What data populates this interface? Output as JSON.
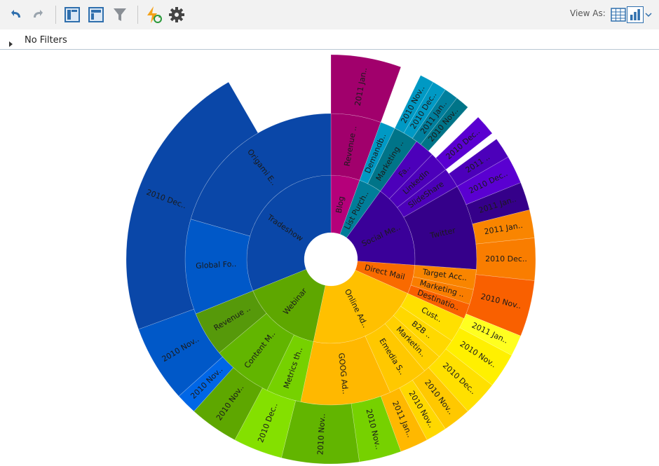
{
  "toolbar": {
    "icons": [
      "undo-icon",
      "redo-icon",
      "layout-panel-icon",
      "layout-header-icon",
      "filter-icon",
      "refresh-icon",
      "gear-icon"
    ],
    "view_as_label": "View As:",
    "view_as_options": [
      "table-view-icon",
      "chart-view-icon"
    ]
  },
  "filters": {
    "label": "No Filters"
  },
  "colors": {
    "toolbar_bg": "#f2f2f2",
    "icon_blue": "#2f6fad",
    "accent_orange": "#f4a21b"
  },
  "chart_data": {
    "type": "sunburst",
    "rings": [
      {
        "level": 1,
        "segments": [
          {
            "label": "Blog",
            "start": 0,
            "end": 10,
            "color": "#b5007a"
          },
          {
            "label": "List Purch..",
            "start": 10,
            "end": 18,
            "color": "#007d99"
          },
          {
            "label": "Social Me..",
            "start": 18,
            "end": 47,
            "color": "#3a0099"
          },
          {
            "label": "Direct Mail",
            "start": 47,
            "end": 57,
            "color": "#f96a00"
          },
          {
            "label": "Online Ad..",
            "start": 57,
            "end": 96,
            "color": "#ffc000"
          },
          {
            "label": "Webinar",
            "start": 96,
            "end": 124,
            "color": "#5ea700"
          },
          {
            "label": "Tradeshow",
            "start": 124,
            "end": 180,
            "color": "#0a47a8"
          }
        ]
      },
      {
        "level": 2,
        "segments": [
          {
            "label": "Revenue ..",
            "start": 0,
            "end": 10,
            "color": "#a1006c"
          },
          {
            "label": "Demandb..",
            "start": 10,
            "end": 13,
            "color": "#0099c4"
          },
          {
            "label": "Marketing ..",
            "start": 13,
            "end": 18,
            "color": "#007488"
          },
          {
            "label": "Fa..",
            "start": 18,
            "end": 22,
            "color": "#4c00ba"
          },
          {
            "label": "LinkedIn",
            "start": 22,
            "end": 26,
            "color": "#4c00ba"
          },
          {
            "label": "SlideShare",
            "start": 26,
            "end": 30,
            "color": "#4c00ba"
          },
          {
            "label": "Twitter",
            "start": 30,
            "end": 47,
            "color": "#35008a"
          },
          {
            "label": "Target Acc..",
            "start": 47,
            "end": 51,
            "color": "#f98500"
          },
          {
            "label": "Marketing ..",
            "start": 51,
            "end": 54,
            "color": "#f97d00"
          },
          {
            "label": "Destinatio..",
            "start": 54,
            "end": 57,
            "color": "#f96000"
          },
          {
            "label": "Cust..",
            "start": 57,
            "end": 62,
            "color": "#ffe000"
          },
          {
            "label": "B2B ..",
            "start": 62,
            "end": 66,
            "color": "#ffd800"
          },
          {
            "label": "Marketin..",
            "start": 66,
            "end": 70,
            "color": "#ffd000"
          },
          {
            "label": "Emedia S..",
            "start": 70,
            "end": 78,
            "color": "#ffc800"
          },
          {
            "label": "GOOG Ad..",
            "start": 78,
            "end": 96,
            "color": "#ffb800"
          },
          {
            "label": "Metrics th..",
            "start": 96,
            "end": 103,
            "color": "#76d100"
          },
          {
            "label": "Content M..",
            "start": 103,
            "end": 115,
            "color": "#62b500"
          },
          {
            "label": "Revenue ..",
            "start": 115,
            "end": 124,
            "color": "#56990a"
          },
          {
            "label": "Global Fo..",
            "start": 124,
            "end": 143,
            "color": "#0058c8"
          },
          {
            "label": "Origami E..",
            "start": 143,
            "end": 180,
            "color": "#0a47a8"
          }
        ]
      },
      {
        "level": 3,
        "segments": [
          {
            "label": "2011 Jan..",
            "start": 0,
            "end": 10,
            "color": "#a1006c"
          },
          {
            "label": "2010 Nov..",
            "start": 13,
            "end": 15,
            "color": "#0099c4"
          },
          {
            "label": "2010 Dec..",
            "start": 15,
            "end": 17,
            "color": "#0099c4"
          },
          {
            "label": "2011 Jan..",
            "start": 17,
            "end": 19,
            "color": "#007f9d"
          },
          {
            "label": "2010 Nov..",
            "start": 19,
            "end": 21,
            "color": "#007488"
          },
          {
            "label": "2010 Dec..",
            "start": 23,
            "end": 26,
            "color": "#5a00d1"
          },
          {
            "label": "2011 ..",
            "start": 27,
            "end": 30,
            "color": "#4c00ba"
          },
          {
            "label": "2010 Dec..",
            "start": 30,
            "end": 34,
            "color": "#5a00d1"
          },
          {
            "label": "2011 Jan..",
            "start": 34,
            "end": 38,
            "color": "#35008a"
          },
          {
            "label": "2011 Jan..",
            "start": 38,
            "end": 42,
            "color": "#f98500"
          },
          {
            "label": "2010 Dec..",
            "start": 42,
            "end": 48,
            "color": "#f97d00"
          },
          {
            "label": "2010 Nov..",
            "start": 48,
            "end": 56,
            "color": "#f96000"
          },
          {
            "label": "2011 Jan..",
            "start": 56,
            "end": 59,
            "color": "#ffff20"
          },
          {
            "label": "2010 Nov..",
            "start": 59,
            "end": 64,
            "color": "#fff000"
          },
          {
            "label": "2010 Dec..",
            "start": 64,
            "end": 69,
            "color": "#ffe000"
          },
          {
            "label": "2010 Nov..",
            "start": 69,
            "end": 73,
            "color": "#ffc800"
          },
          {
            "label": "2010 Nov..",
            "start": 73,
            "end": 76,
            "color": "#ffd800"
          },
          {
            "label": "2011 Jan..",
            "start": 76,
            "end": 80,
            "color": "#ffb800"
          },
          {
            "label": "2010 Nov..",
            "start": 80,
            "end": 86,
            "color": "#76d100"
          },
          {
            "label": "2010 Nov..",
            "start": 86,
            "end": 97,
            "color": "#62b500"
          },
          {
            "label": "2010 Dec..",
            "start": 97,
            "end": 104,
            "color": "#84e000"
          },
          {
            "label": "2010 Nov..",
            "start": 104,
            "end": 111,
            "color": "#5ea700"
          },
          {
            "label": "2010 Nov..",
            "start": 111,
            "end": 114,
            "color": "#0066e6"
          },
          {
            "label": "2010 Nov..",
            "start": 114,
            "end": 125,
            "color": "#0058c8"
          },
          {
            "label": "2010 Dec..",
            "start": 125,
            "end": 165,
            "color": "#0a47a8"
          }
        ]
      }
    ]
  }
}
